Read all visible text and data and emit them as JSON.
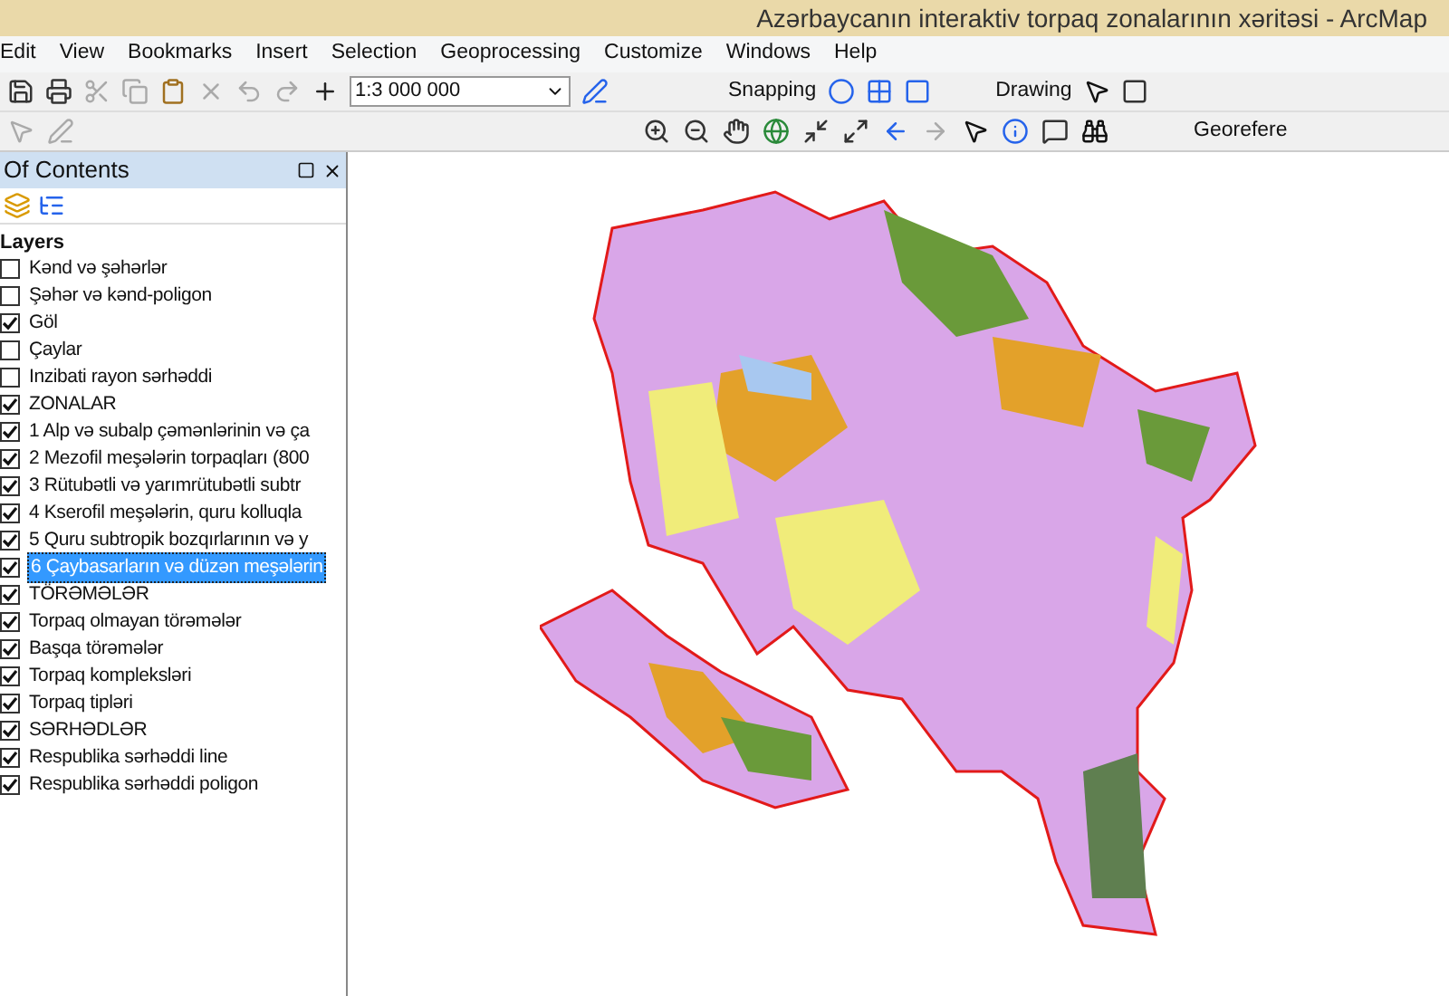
{
  "window": {
    "title": "Azərbaycanın interaktiv torpaq zonalarının xəritəsi - ArcMap"
  },
  "menu": [
    "Edit",
    "View",
    "Bookmarks",
    "Insert",
    "Selection",
    "Geoprocessing",
    "Customize",
    "Windows",
    "Help"
  ],
  "toolbar": {
    "scale": "1:3 000 000",
    "snapping": "Snapping",
    "drawing": "Drawing",
    "georeferencing": "Georefere"
  },
  "toc": {
    "title": "Of Contents",
    "root": "Layers",
    "layers": [
      {
        "label": "Kənd və şəhərlər",
        "checked": false,
        "selected": false
      },
      {
        "label": "Şəhər və kənd-poligon",
        "checked": false,
        "selected": false
      },
      {
        "label": "Göl",
        "checked": true,
        "selected": false
      },
      {
        "label": "Çaylar",
        "checked": false,
        "selected": false
      },
      {
        "label": "Inzibati rayon sərhəddi",
        "checked": false,
        "selected": false
      },
      {
        "label": "ZONALAR",
        "checked": true,
        "selected": false
      },
      {
        "label": "1 Alp və subalp çəmənlərinin və ça",
        "checked": true,
        "selected": false
      },
      {
        "label": "2 Mezofil meşələrin torpaqları (800",
        "checked": true,
        "selected": false
      },
      {
        "label": "3 Rütubətli və yarımrütubətli subtr",
        "checked": true,
        "selected": false
      },
      {
        "label": "4 Kserofil meşələrin, quru  kolluqla",
        "checked": true,
        "selected": false
      },
      {
        "label": "5 Quru subtropik bozqırlarının və y",
        "checked": true,
        "selected": false
      },
      {
        "label": "6 Çaybasarların və düzən meşələrin",
        "checked": true,
        "selected": true
      },
      {
        "label": "TÖRƏMƏLƏR",
        "checked": true,
        "selected": false
      },
      {
        "label": "Torpaq olmayan törəmələr",
        "checked": true,
        "selected": false
      },
      {
        "label": "Başqa törəmələr",
        "checked": true,
        "selected": false
      },
      {
        "label": "Torpaq kompleksləri",
        "checked": true,
        "selected": false
      },
      {
        "label": "Torpaq tipləri",
        "checked": true,
        "selected": false
      },
      {
        "label": "SƏRHƏDLƏR",
        "checked": true,
        "selected": false
      },
      {
        "label": "Respublika sərhəddi line",
        "checked": true,
        "selected": false
      },
      {
        "label": "Respublika sərhəddi poligon",
        "checked": true,
        "selected": false
      }
    ]
  }
}
